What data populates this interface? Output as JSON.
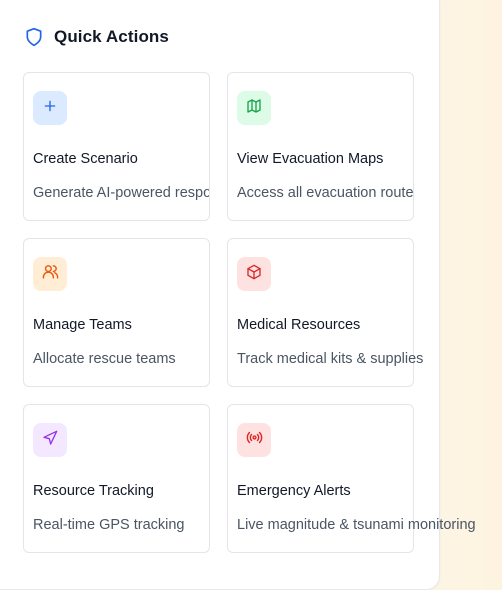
{
  "panel": {
    "title": "Quick Actions",
    "icon": "shield-icon"
  },
  "actions": [
    {
      "title": "Create Scenario",
      "description": "Generate AI-powered response",
      "icon": "plus-icon",
      "icon_color": "#2563eb",
      "icon_bg": "#dbeafe"
    },
    {
      "title": "View Evacuation Maps",
      "description": "Access all evacuation routes",
      "icon": "map-icon",
      "icon_color": "#16a34a",
      "icon_bg": "#dcfce7"
    },
    {
      "title": "Manage Teams",
      "description": "Allocate rescue teams",
      "icon": "users-icon",
      "icon_color": "#ea580c",
      "icon_bg": "#ffedd5"
    },
    {
      "title": "Medical Resources",
      "description": "Track medical kits & supplies",
      "icon": "package-icon",
      "icon_color": "#dc2626",
      "icon_bg": "#fee2e2"
    },
    {
      "title": "Resource Tracking",
      "description": "Real-time GPS tracking",
      "icon": "navigation-icon",
      "icon_color": "#9333ea",
      "icon_bg": "#f3e8ff"
    },
    {
      "title": "Emergency Alerts",
      "description": "Live magnitude & tsunami monitoring",
      "icon": "radio-icon",
      "icon_color": "#dc2626",
      "icon_bg": "#fee2e2"
    }
  ]
}
